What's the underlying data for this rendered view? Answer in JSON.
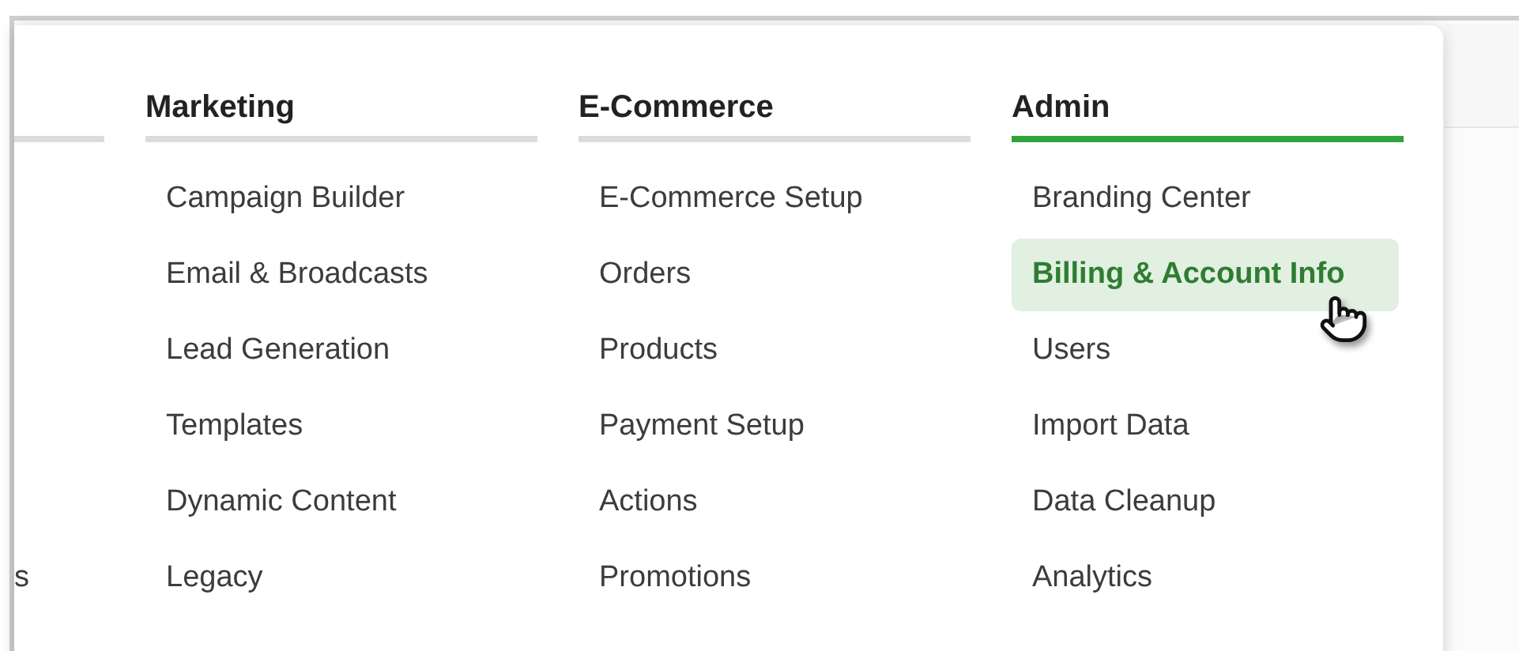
{
  "menu": {
    "columns": [
      {
        "selected": false,
        "items": [
          {
            "label": "s",
            "selected": false
          }
        ]
      },
      {
        "heading": "Marketing",
        "selected": false,
        "items": [
          {
            "label": "Campaign Builder",
            "selected": false
          },
          {
            "label": "Email & Broadcasts",
            "selected": false
          },
          {
            "label": "Lead Generation",
            "selected": false
          },
          {
            "label": "Templates",
            "selected": false
          },
          {
            "label": "Dynamic Content",
            "selected": false
          },
          {
            "label": "Legacy",
            "selected": false
          }
        ]
      },
      {
        "heading": "E-Commerce",
        "selected": false,
        "items": [
          {
            "label": "E-Commerce Setup",
            "selected": false
          },
          {
            "label": "Orders",
            "selected": false
          },
          {
            "label": "Products",
            "selected": false
          },
          {
            "label": "Payment Setup",
            "selected": false
          },
          {
            "label": "Actions",
            "selected": false
          },
          {
            "label": "Promotions",
            "selected": false
          }
        ]
      },
      {
        "heading": "Admin",
        "selected": true,
        "items": [
          {
            "label": "Branding Center",
            "selected": false
          },
          {
            "label": "Billing & Account Info",
            "selected": true
          },
          {
            "label": "Users",
            "selected": false
          },
          {
            "label": "Import Data",
            "selected": false
          },
          {
            "label": "Data Cleanup",
            "selected": false
          },
          {
            "label": "Analytics",
            "selected": false
          }
        ]
      }
    ]
  }
}
